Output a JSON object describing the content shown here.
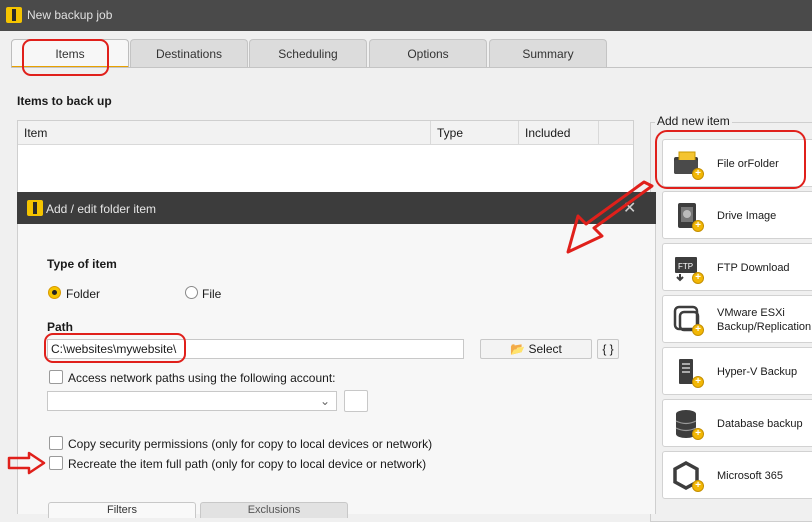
{
  "window": {
    "title": "New backup job"
  },
  "tabs": [
    "Items",
    "Destinations",
    "Scheduling",
    "Options",
    "Summary"
  ],
  "items_section": {
    "title": "Items to back up",
    "columns": [
      "Item",
      "Type",
      "Included"
    ]
  },
  "add_new": {
    "label": "Add new item",
    "items": [
      {
        "label": "File orFolder",
        "icon": "folder-file-icon"
      },
      {
        "label": "Drive Image",
        "icon": "drive-image-icon"
      },
      {
        "label": "FTP Download",
        "icon": "ftp-download-icon"
      },
      {
        "label": "VMware ESXi Backup/Replication",
        "icon": "vmware-icon"
      },
      {
        "label": "Hyper-V Backup",
        "icon": "hyperv-icon"
      },
      {
        "label": "Database backup",
        "icon": "database-icon"
      },
      {
        "label": "Microsoft 365",
        "icon": "microsoft-365-icon"
      }
    ]
  },
  "dialog": {
    "title": "Add / edit folder item",
    "type_label": "Type of item",
    "type_options": [
      "Folder",
      "File"
    ],
    "type_selected": "Folder",
    "path_label": "Path",
    "path_value": "C:\\websites\\mywebsite\\",
    "select_button": "Select",
    "vars_button": "{ }",
    "network_checkbox": "Access network paths using the following account:",
    "copy_perm_checkbox": "Copy security permissions (only for copy to local devices or network)",
    "recreate_checkbox": "Recreate the item full path (only for copy to local device or network)",
    "subtabs": [
      "Filters",
      "Exclusions"
    ]
  },
  "colors": {
    "accent": "#f5c400",
    "annotation": "#e0201b",
    "titlebar": "#4a4a4a"
  }
}
